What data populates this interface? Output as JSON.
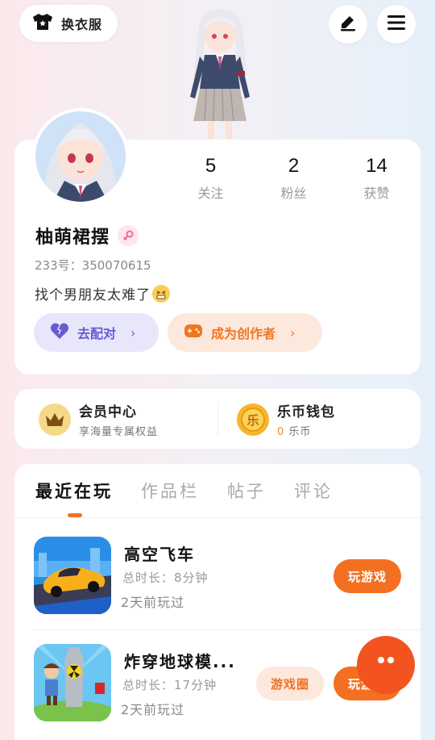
{
  "topbar": {
    "dress_label": "换衣服",
    "icons": [
      "tshirt-icon",
      "edit-icon",
      "menu-icon"
    ]
  },
  "profile": {
    "stats": [
      {
        "value": "5",
        "label": "关注"
      },
      {
        "value": "2",
        "label": "粉丝"
      },
      {
        "value": "14",
        "label": "获赞"
      }
    ],
    "name": "柚萌裙摆",
    "uid_label": "233号",
    "uid_sep": "：",
    "uid_value": "350070615",
    "bio": "找个男朋友太难了",
    "match_label": "去配对",
    "creator_label": "成为创作者",
    "chevron": "›"
  },
  "membership": {
    "vip_title": "会员中心",
    "vip_sub": "享海量专属权益",
    "wallet_title": "乐币钱包",
    "wallet_amount": "0",
    "wallet_unit": "乐币",
    "wallet_icon_char": "乐"
  },
  "games": {
    "tabs": [
      "最近在玩",
      "作品栏",
      "帖子",
      "评论"
    ],
    "items": [
      {
        "title": "高空飞车",
        "duration": "总时长：8分钟",
        "last_played": "2天前玩过",
        "play_label": "玩游戏"
      },
      {
        "title": "炸穿地球模...",
        "duration": "总时长：17分钟",
        "last_played": "2天前玩过",
        "circle_label": "游戏圈",
        "play_label": "玩游戏"
      }
    ]
  },
  "colors": {
    "accent": "#f37021",
    "match_bg": "#e7e6fb",
    "match_text": "#6a5ad0",
    "creator_bg": "#fde8de"
  }
}
